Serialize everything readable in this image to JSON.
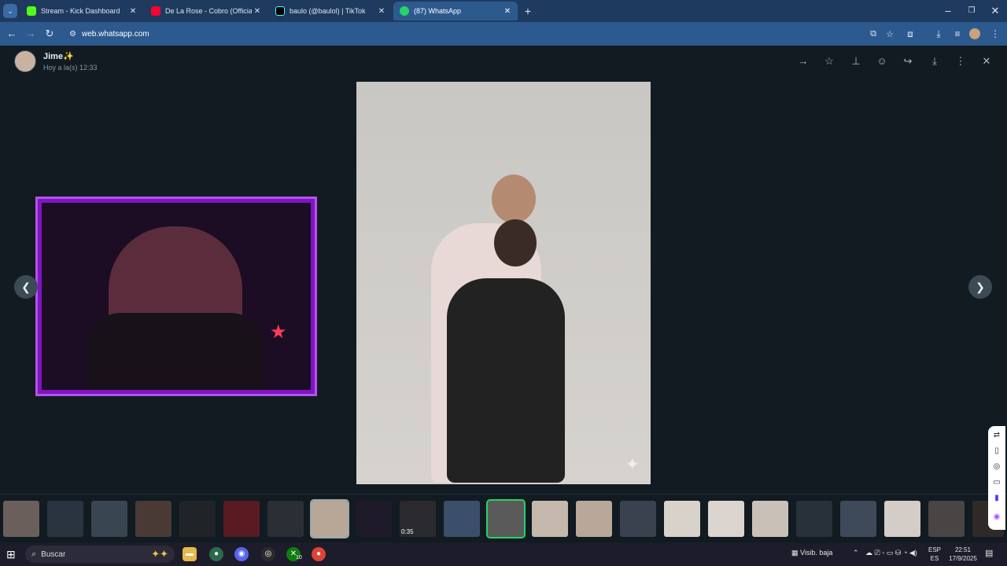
{
  "browser": {
    "tabs": [
      {
        "title": "Stream - Kick Dashboard",
        "icon": "kick-icon",
        "color": "#53fc18",
        "active": false
      },
      {
        "title": "De La Rose - Cobro (Official Vid",
        "icon": "youtube-icon",
        "color": "#ff0033",
        "active": false
      },
      {
        "title": "baulo (@baulol) | TikTok",
        "icon": "tiktok-icon",
        "color": "#000000",
        "active": false
      },
      {
        "title": "(87) WhatsApp",
        "icon": "whatsapp-icon",
        "color": "#25d366",
        "active": true
      }
    ],
    "new_tab": "+",
    "url": "web.whatsapp.com"
  },
  "viewer": {
    "contact_name": "Jime✨",
    "timestamp": "Hoy a la(s) 12:33",
    "actions": [
      "forward-icon",
      "star-icon",
      "pin-icon",
      "emoji-icon",
      "share-icon",
      "download-icon",
      "more-icon",
      "close-icon"
    ],
    "prev_label": "❮",
    "next_label": "❯",
    "video_duration": "0:35"
  },
  "taskbar": {
    "search_placeholder": "Buscar",
    "visibility": "Visib. baja",
    "lang_top": "ESP",
    "lang_bottom": "ES",
    "time": "22:51",
    "date": "17/9/2025",
    "badge": "10"
  },
  "thumb_colors": [
    "#6a5f5a",
    "#2a3440",
    "#3a4552",
    "#4a3a35",
    "#202428",
    "#5a1a22",
    "#2a2f35",
    "#b8a797",
    "#1e1a2a",
    "#2a2a2e",
    "#3b4f6a",
    "#5a5a5a",
    "#c4b8ad",
    "#b9a79a",
    "#3a4250",
    "#d9d2ca",
    "#dcd5cf",
    "#c9c1b8",
    "#28303a",
    "#3e4a5a",
    "#d4cdc7",
    "#4a4545",
    "#2f2a28"
  ]
}
